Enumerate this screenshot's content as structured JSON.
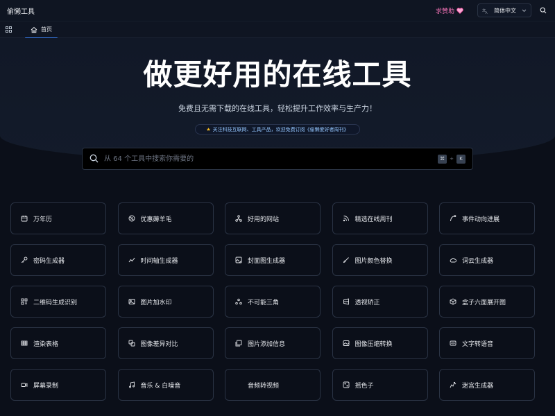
{
  "header": {
    "brand": "偷懒工具",
    "sponsor_label": "求赞助",
    "language": "简体中文"
  },
  "tabs": [
    {
      "label": "首页",
      "icon": "home-icon",
      "active": true
    }
  ],
  "hero": {
    "title": "做更好用的在线工具",
    "subtitle": "免费且无需下载的在线工具，轻松提升工作效率与生产力！",
    "notice": "关注科技互联网、工具产品，欢迎免费订阅《偷懒爱好者周刊》"
  },
  "search": {
    "placeholder": "从 64 个工具中搜索你需要的",
    "shortcut_mod": "⌘",
    "shortcut_sep": "+",
    "shortcut_key": "K"
  },
  "tools": [
    {
      "label": "万年历",
      "icon": "calendar-icon"
    },
    {
      "label": "优惠薅羊毛",
      "icon": "coupon-icon"
    },
    {
      "label": "好用的网站",
      "icon": "sitemap-icon"
    },
    {
      "label": "精选在线周刊",
      "icon": "rss-icon"
    },
    {
      "label": "事件动向进展",
      "icon": "timeline-curve-icon"
    },
    {
      "label": "密码生成器",
      "icon": "key-icon"
    },
    {
      "label": "时间轴生成器",
      "icon": "trend-icon"
    },
    {
      "label": "封面图生成器",
      "icon": "image-edit-icon"
    },
    {
      "label": "图片颜色替换",
      "icon": "brush-icon"
    },
    {
      "label": "词云生成器",
      "icon": "cloud-icon"
    },
    {
      "label": "二维码生成识别",
      "icon": "qrcode-icon"
    },
    {
      "label": "图片加水印",
      "icon": "image-icon"
    },
    {
      "label": "不可能三角",
      "icon": "triangle-nodes-icon"
    },
    {
      "label": "透视矫正",
      "icon": "perspective-icon"
    },
    {
      "label": "盒子六面展开图",
      "icon": "box-icon"
    },
    {
      "label": "渲染表格",
      "icon": "table-icon"
    },
    {
      "label": "图像差异对比",
      "icon": "compare-icon"
    },
    {
      "label": "图片添加信息",
      "icon": "image-info-icon"
    },
    {
      "label": "图像压缩转换",
      "icon": "image-compress-icon"
    },
    {
      "label": "文字转语音",
      "icon": "speech-icon"
    },
    {
      "label": "屏幕录制",
      "icon": "video-icon"
    },
    {
      "label": "音乐 & 白噪音",
      "icon": "music-icon"
    },
    {
      "label": "音频转视频",
      "icon": "audio-video-icon"
    },
    {
      "label": "摇色子",
      "icon": "dice-icon"
    },
    {
      "label": "迷宫生成器",
      "icon": "maze-icon"
    }
  ],
  "colors": {
    "accent": "#3b82f6",
    "sponsor": "#f472b6",
    "background": "#0b0f19"
  }
}
